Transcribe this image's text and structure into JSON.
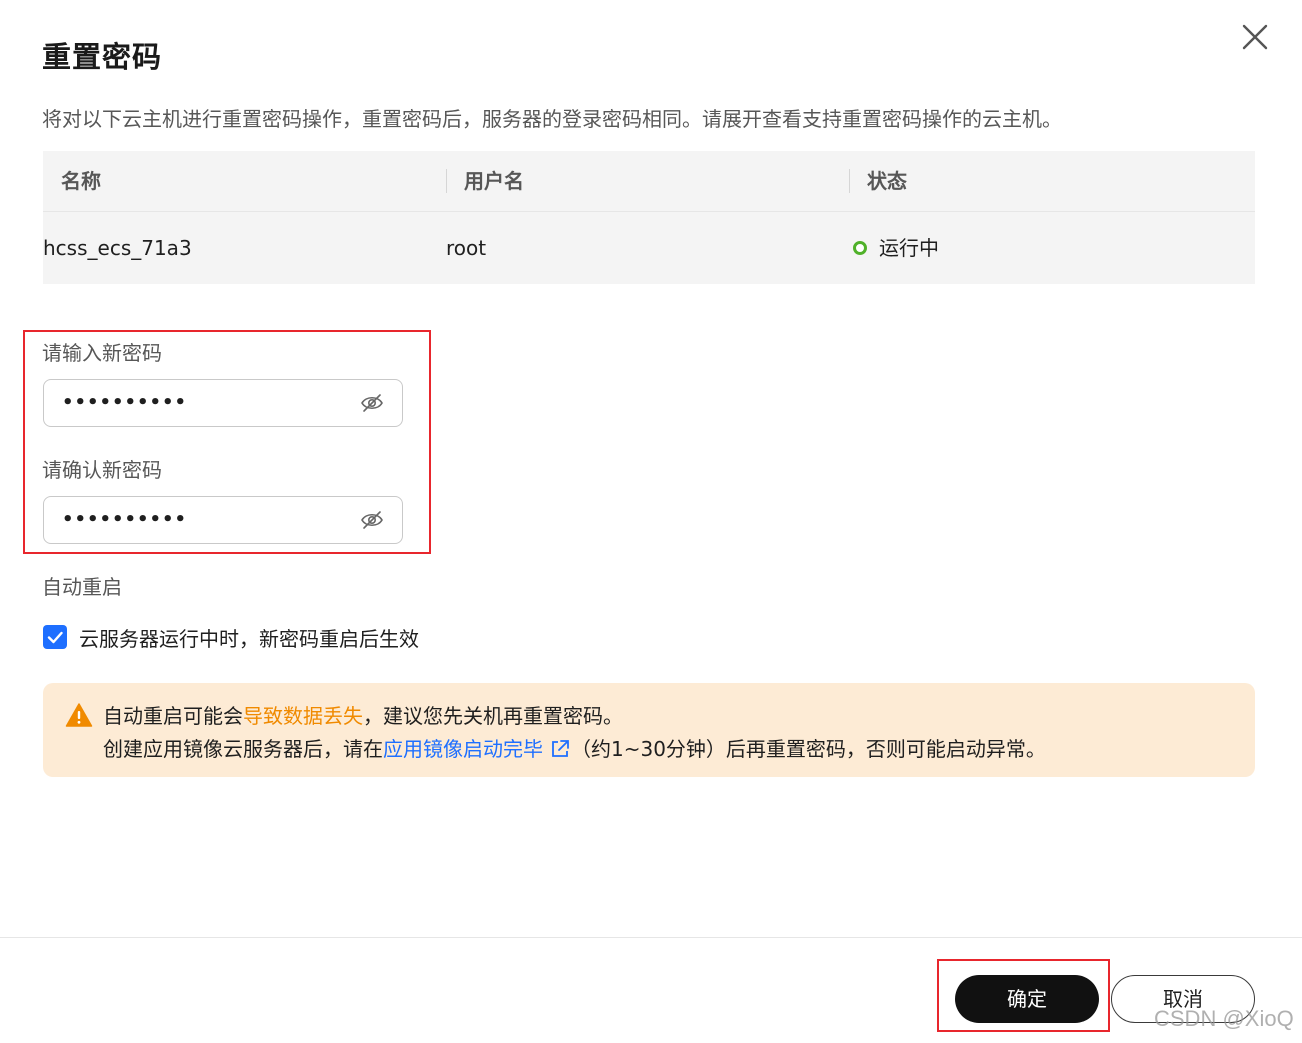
{
  "dialog": {
    "title": "重置密码",
    "description": "将对以下云主机进行重置密码操作，重置密码后，服务器的登录密码相同。请展开查看支持重置密码操作的云主机。"
  },
  "table": {
    "headers": [
      "名称",
      "用户名",
      "状态"
    ],
    "rows": [
      {
        "name": "hcss_ecs_71a3",
        "username": "root",
        "status": "运行中"
      }
    ]
  },
  "form": {
    "new_password_label": "请输入新密码",
    "new_password_value": "••••••••••",
    "confirm_password_label": "请确认新密码",
    "confirm_password_value": "••••••••••",
    "auto_restart_label": "自动重启",
    "auto_restart_checked": true,
    "auto_restart_checkbox_text": "云服务器运行中时，新密码重启后生效"
  },
  "alert": {
    "line1_prefix": "自动重启可能会",
    "line1_warning": "导致数据丢失",
    "line1_suffix": "，建议您先关机再重置密码。",
    "line2_prefix": "创建应用镜像云服务器后，请在",
    "line2_link": "应用镜像启动完毕",
    "line2_suffix": "（约1~30分钟）后再重置密码，否则可能启动异常。"
  },
  "footer": {
    "confirm_label": "确定",
    "cancel_label": "取消"
  },
  "watermark": "CSDN @XioQ",
  "colors": {
    "primary_button": "#111111",
    "link": "#1e6fff",
    "warning": "#f08a00",
    "alert_background": "#fdebd5",
    "status_running": "#50b12a",
    "highlight": "#e8262d"
  }
}
